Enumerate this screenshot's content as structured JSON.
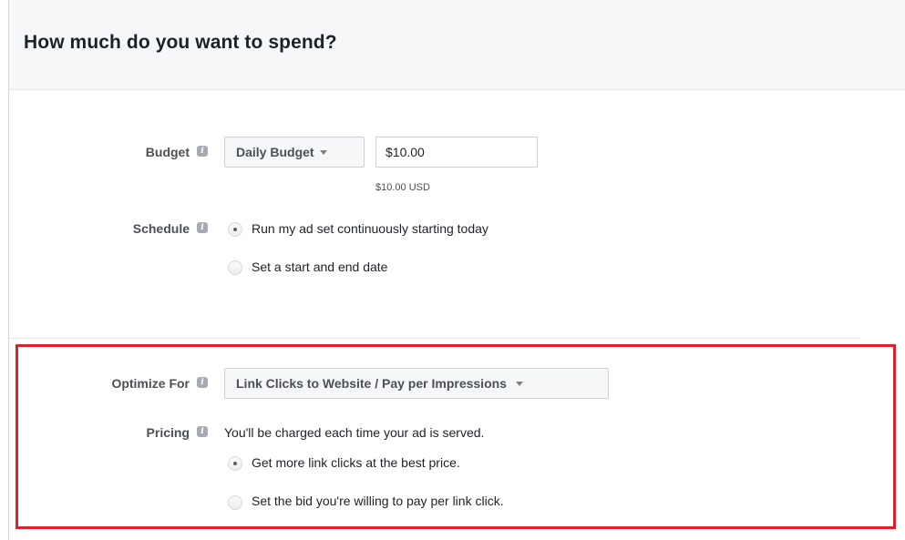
{
  "header": {
    "title": "How much do you want to spend?"
  },
  "budget": {
    "label": "Budget",
    "type_select": "Daily Budget",
    "amount_value": "$10.00",
    "amount_helper": "$10.00 USD"
  },
  "schedule": {
    "label": "Schedule",
    "options": [
      {
        "label": "Run my ad set continuously starting today",
        "selected": true
      },
      {
        "label": "Set a start and end date",
        "selected": false
      }
    ]
  },
  "optimize": {
    "label": "Optimize For",
    "select_value": "Link Clicks to Website / Pay per Impressions"
  },
  "pricing": {
    "label": "Pricing",
    "description": "You'll be charged each time your ad is served.",
    "options": [
      {
        "label": "Get more link clicks at the best price.",
        "selected": true
      },
      {
        "label": "Set the bid you're willing to pay per link click.",
        "selected": false
      }
    ]
  },
  "icons": {
    "info": "i"
  },
  "colors": {
    "highlight": "#d9232a",
    "header_bg": "#f6f7f9"
  }
}
